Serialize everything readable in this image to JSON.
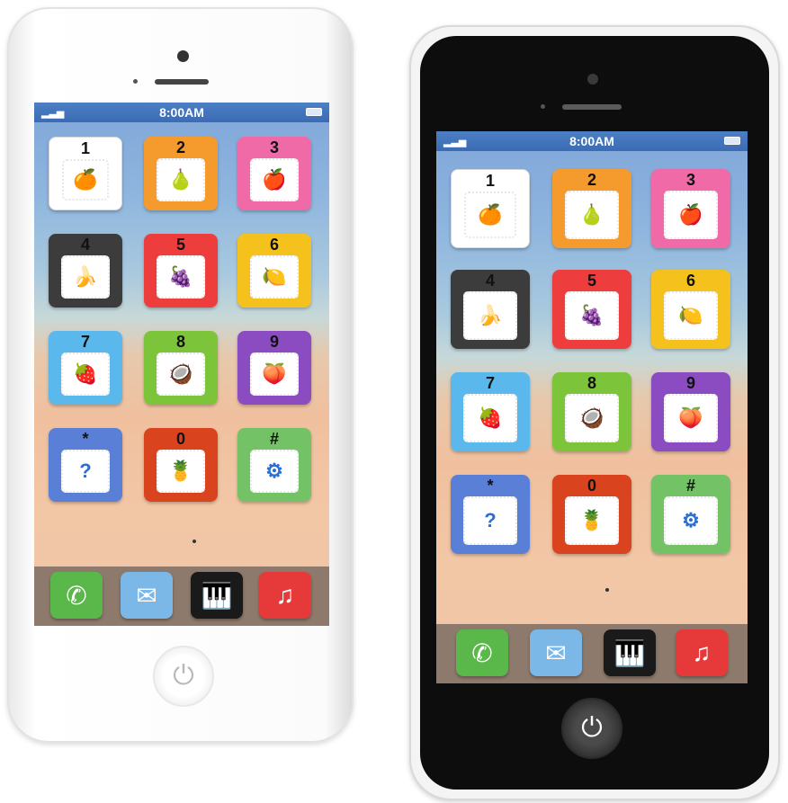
{
  "statusbar": {
    "time": "8:00AM",
    "signal_icon": "signal-bars-icon",
    "battery_icon": "battery-icon"
  },
  "keys": [
    {
      "label": "1",
      "icon": "orange-icon",
      "glyph": "🍊",
      "color": "#ffffff"
    },
    {
      "label": "2",
      "icon": "pear-icon",
      "glyph": "🍐",
      "color": "#f59a2d"
    },
    {
      "label": "3",
      "icon": "apple-icon",
      "glyph": "🍎",
      "color": "#f06aa8"
    },
    {
      "label": "4",
      "icon": "banana-icon",
      "glyph": "🍌",
      "color": "#3c3c3c"
    },
    {
      "label": "5",
      "icon": "grapes-icon",
      "glyph": "🍇",
      "color": "#ee3d3d"
    },
    {
      "label": "6",
      "icon": "lemon-icon",
      "glyph": "🍋",
      "color": "#f5c11c"
    },
    {
      "label": "7",
      "icon": "strawberry-icon",
      "glyph": "🍓",
      "color": "#5ab8ec"
    },
    {
      "label": "8",
      "icon": "coconut-icon",
      "glyph": "🥥",
      "color": "#7cc43a"
    },
    {
      "label": "9",
      "icon": "peach-icon",
      "glyph": "🍑",
      "color": "#8b4cc2"
    },
    {
      "label": "*",
      "icon": "question-icon",
      "glyph": "?",
      "color": "#5a7fd6"
    },
    {
      "label": "0",
      "icon": "pineapple-icon",
      "glyph": "🍍",
      "color": "#d9441f"
    },
    {
      "label": "#",
      "icon": "gear-icon",
      "glyph": "⚙",
      "color": "#74c266"
    }
  ],
  "dock": [
    {
      "name": "phone-icon",
      "glyph": "✆",
      "color": "#5ab84a"
    },
    {
      "name": "mail-icon",
      "glyph": "✉",
      "color": "#7bb8e8"
    },
    {
      "name": "piano-icon",
      "glyph": "🎹",
      "color": "#1a1a1a"
    },
    {
      "name": "music-icon",
      "glyph": "♫",
      "color": "#e63a3a"
    }
  ],
  "home_icon": "power-icon",
  "home_glyph": "⏻"
}
